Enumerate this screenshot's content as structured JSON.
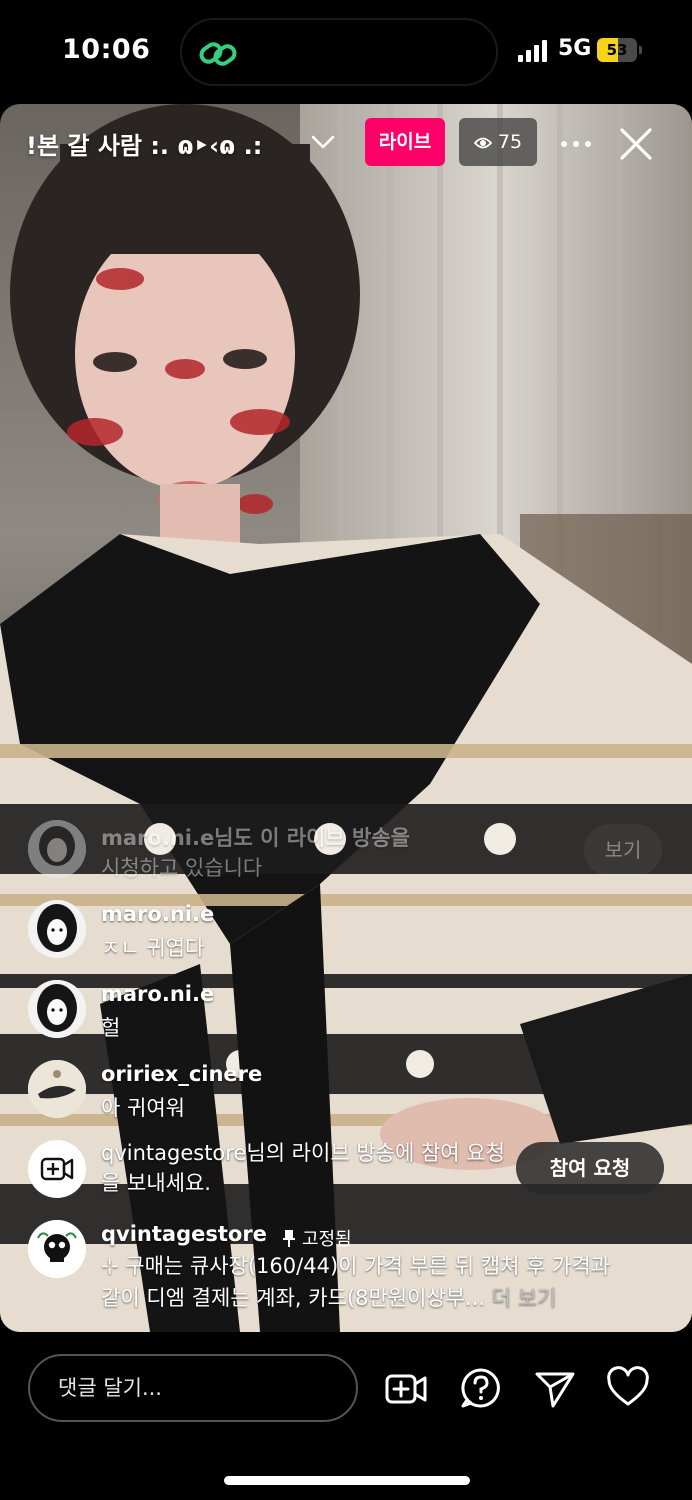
{
  "status_bar": {
    "time": "10:06",
    "network": "5G",
    "battery_level": 53,
    "battery_label": "53",
    "battery_color": "#f5d317",
    "island_icon": "link-icon"
  },
  "live": {
    "title": "!본 갈 사람 :. ɷ‣‹ɷ .:",
    "live_label": "라이브",
    "viewer_count": "75",
    "accent": "#ff0069"
  },
  "comments": [
    {
      "user": "maro.ni.e님도 이 라이브 방송을",
      "text": "시청하고 있습니다",
      "button": "보기",
      "faded": true
    },
    {
      "user": "maro.ni.e",
      "text": "ㅈㄴ 귀엽다"
    },
    {
      "user": "maro.ni.e",
      "text": "헐"
    },
    {
      "user": "oririex_cinere",
      "text": "아 귀여워"
    }
  ],
  "join_request": {
    "text": "qvintagestore님의 라이브 방송에 참여 요청을 보내세요.",
    "button": "참여 요청"
  },
  "pinned": {
    "user": "qvintagestore",
    "tag": "고정됨",
    "line1": "⊹ 구매는 큐사장(160/44)이 가격 부른 뒤 캡쳐 후 가격과",
    "line2": "같이 디엠 결제는 계좌, 카드(8만원이상부...",
    "more": "더 보기"
  },
  "bottom_bar": {
    "placeholder": "댓글 달기...",
    "icons": [
      "add-video-icon",
      "question-icon",
      "send-icon",
      "heart-icon"
    ]
  }
}
